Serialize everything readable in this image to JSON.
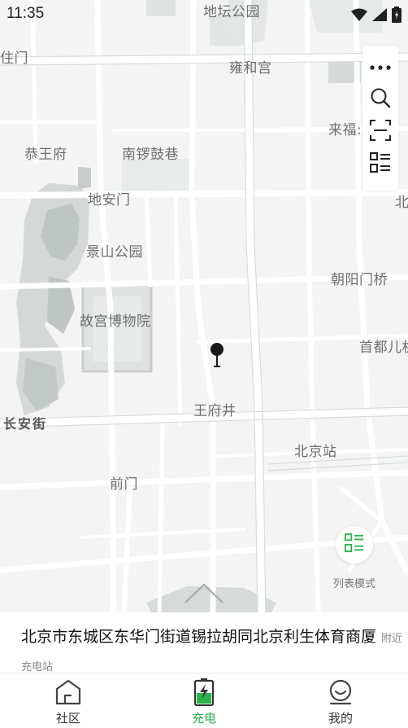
{
  "status_bar": {
    "time": "11:35"
  },
  "map": {
    "labels": [
      {
        "text": "地坛公园",
        "style": "normal"
      },
      {
        "text": "雍和宫",
        "style": "normal"
      },
      {
        "text": "来福:",
        "style": "normal"
      },
      {
        "text": "北",
        "style": "normal"
      },
      {
        "text": "恭王府",
        "style": "normal"
      },
      {
        "text": "南锣鼓巷",
        "style": "normal"
      },
      {
        "text": "地安门",
        "style": "normal"
      },
      {
        "text": "景山公园",
        "style": "normal"
      },
      {
        "text": "朝阳门桥",
        "style": "normal"
      },
      {
        "text": "故宫博物院",
        "style": "normal"
      },
      {
        "text": "首都儿机",
        "style": "normal"
      },
      {
        "text": "王府井",
        "style": "normal"
      },
      {
        "text": "长安街",
        "style": "bold"
      },
      {
        "text": "北京站",
        "style": "normal"
      },
      {
        "text": "前门",
        "style": "normal"
      },
      {
        "text": "住门",
        "style": "normal"
      }
    ]
  },
  "toolbar": {
    "more": "more-icon",
    "search": "search-icon",
    "scan": "scan-icon",
    "list": "list-icon"
  },
  "list_mode": {
    "label": "列表模式"
  },
  "sheet": {
    "address": "北京市东城区东华门街道锡拉胡同北京利生体育商厦",
    "nearby": "附近充电站"
  },
  "tabs": [
    {
      "label": "社区",
      "icon": "home-icon",
      "active": false
    },
    {
      "label": "充电",
      "icon": "charge-icon",
      "active": true
    },
    {
      "label": "我的",
      "icon": "profile-icon",
      "active": false
    }
  ],
  "colors": {
    "accent": "#2bb24c",
    "map_bg": "#f4f4f4",
    "park": "#d3d7d5",
    "road": "#ffffff"
  }
}
